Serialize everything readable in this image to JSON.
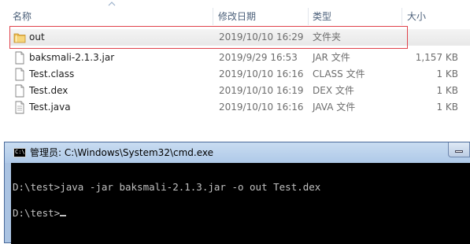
{
  "explorer": {
    "columns": {
      "name": "名称",
      "date": "修改日期",
      "type": "类型",
      "size": "大小"
    },
    "files": [
      {
        "name": "out",
        "date": "2019/10/10 16:29",
        "type": "文件夹",
        "size": "",
        "icon": "folder-icon",
        "selected": true
      },
      {
        "name": "baksmali-2.1.3.jar",
        "date": "2019/9/29 16:53",
        "type": "JAR 文件",
        "size": "1,157 KB",
        "icon": "file-icon"
      },
      {
        "name": "Test.class",
        "date": "2019/10/10 16:16",
        "type": "CLASS 文件",
        "size": "1 KB",
        "icon": "file-icon"
      },
      {
        "name": "Test.dex",
        "date": "2019/10/10 16:19",
        "type": "DEX 文件",
        "size": "1 KB",
        "icon": "file-icon"
      },
      {
        "name": "Test.java",
        "date": "2019/10/10 16:16",
        "type": "JAVA 文件",
        "size": "1 KB",
        "icon": "text-file-icon"
      }
    ],
    "highlight_color": "#e0424a"
  },
  "cmd": {
    "icon_text": "C:\\",
    "title": "管理员: C:\\Windows\\System32\\cmd.exe",
    "lines": [
      "D:\\test>java -jar baksmali-2.1.3.jar -o out Test.dex",
      "D:\\test>"
    ],
    "background": "#000000",
    "foreground": "#c0c0c0"
  }
}
